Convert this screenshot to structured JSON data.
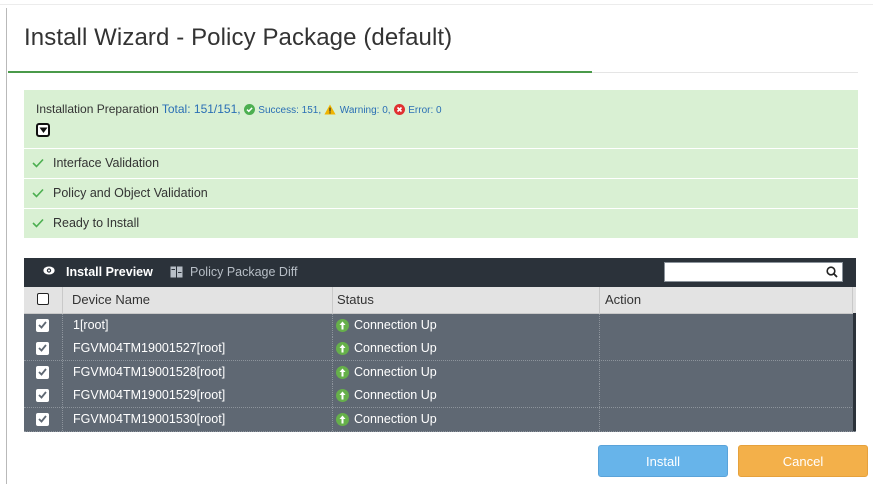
{
  "dialog": {
    "title": "Install Wizard - Policy Package (default)"
  },
  "preparation": {
    "label": "Installation Preparation",
    "total": "Total: 151/151,",
    "success": "Success: 151,",
    "warning": "Warning: 0,",
    "error": "Error: 0"
  },
  "steps": [
    {
      "label": "Interface Validation"
    },
    {
      "label": "Policy and Object Validation"
    },
    {
      "label": "Ready to Install"
    }
  ],
  "toolbar": {
    "install_preview": "Install Preview",
    "policy_package_diff": "Policy Package Diff",
    "search_placeholder": ""
  },
  "table": {
    "columns": [
      "Device Name",
      "Status",
      "Action"
    ],
    "rows": [
      {
        "device": "1[root]",
        "status": "Connection Up",
        "action": "",
        "checked": true
      },
      {
        "device": "FGVM04TM19001527[root]",
        "status": "Connection Up",
        "action": "",
        "checked": true
      },
      {
        "device": "FGVM04TM19001528[root]",
        "status": "Connection Up",
        "action": "",
        "checked": true
      },
      {
        "device": "FGVM04TM19001529[root]",
        "status": "Connection Up",
        "action": "",
        "checked": true
      },
      {
        "device": "FGVM04TM19001530[root]",
        "status": "Connection Up",
        "action": "",
        "checked": true
      }
    ]
  },
  "buttons": {
    "install": "Install",
    "cancel": "Cancel"
  },
  "colors": {
    "success_bg": "#d9f0d3",
    "toolbar_bg": "#2b323a",
    "row_bg": "#5f6873",
    "install_btn": "#67b4ea",
    "cancel_btn": "#f3b04a",
    "progress": "#4a9a4a"
  },
  "icons": {
    "check": "check-icon",
    "success": "success-icon",
    "warning": "warning-icon",
    "error": "error-icon",
    "preview": "eye-icon",
    "diff": "diff-icon",
    "search": "search-icon"
  }
}
